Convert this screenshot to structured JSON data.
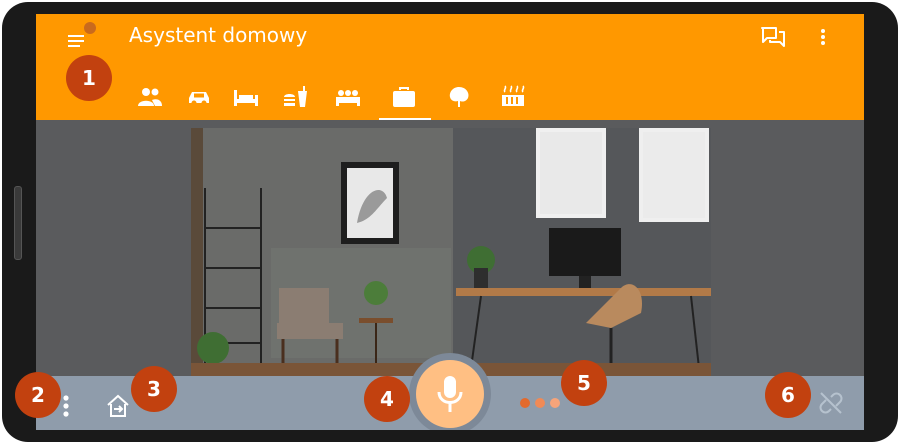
{
  "app": {
    "title": "Asystent domowy"
  },
  "toolbar": {
    "icons": [
      "menu-icon",
      "chat-icon",
      "more-vert-icon"
    ]
  },
  "tabs": [
    {
      "icon": "people-icon",
      "active": false
    },
    {
      "icon": "car-icon",
      "active": false
    },
    {
      "icon": "bed-icon",
      "active": false
    },
    {
      "icon": "fastfood-icon",
      "active": false
    },
    {
      "icon": "hotel-icon",
      "active": false
    },
    {
      "icon": "briefcase-icon",
      "active": true
    },
    {
      "icon": "tree-icon",
      "active": false
    },
    {
      "icon": "heater-icon",
      "active": false
    }
  ],
  "main": {
    "image": "room-photo"
  },
  "bottombar": {
    "icons": [
      "more-vert-icon",
      "home-exit-icon",
      "mic-icon",
      "unlink-icon"
    ]
  },
  "badges": [
    "1",
    "2",
    "3",
    "4",
    "5",
    "6"
  ],
  "colors": {
    "appbar": "#ff9800",
    "bottombar": "#8f9cab",
    "mic": "#ffbf83",
    "badge": "#c2410f",
    "background": "#5a5b5d"
  }
}
